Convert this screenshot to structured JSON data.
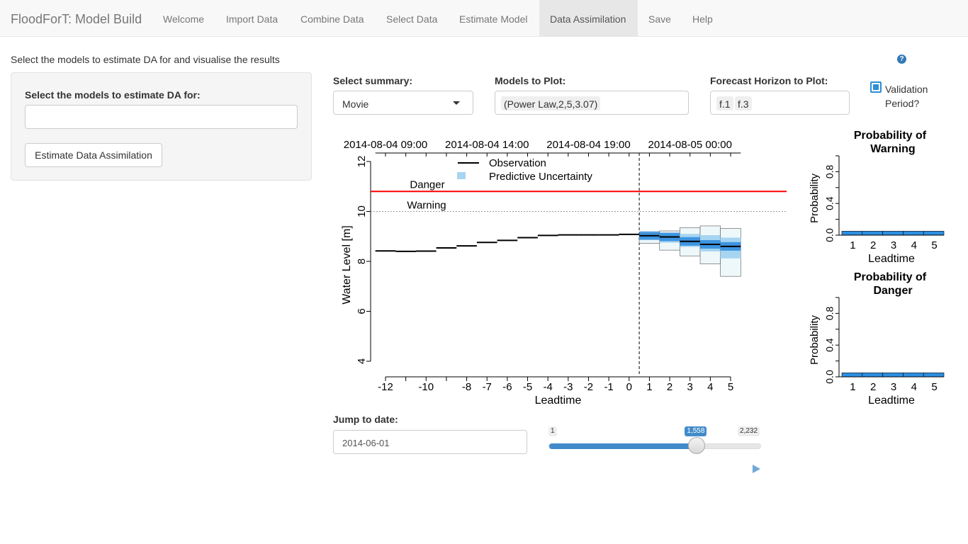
{
  "app": {
    "title": "FloodForT: Model Build"
  },
  "nav": {
    "tabs": [
      {
        "label": "Welcome"
      },
      {
        "label": "Import Data"
      },
      {
        "label": "Combine Data"
      },
      {
        "label": "Select Data"
      },
      {
        "label": "Estimate Model"
      },
      {
        "label": "Data Assimilation",
        "active": true
      },
      {
        "label": "Save"
      },
      {
        "label": "Help"
      }
    ]
  },
  "page": {
    "intro": "Select the models to estimate DA for and visualise the results",
    "help_icon": "?"
  },
  "sidebar": {
    "models_label": "Select the models to estimate DA for:",
    "models_value": "",
    "estimate_button": "Estimate Data Assimilation"
  },
  "controls": {
    "summary_label": "Select summary:",
    "summary_value": "Movie",
    "models_plot_label": "Models to Plot:",
    "models_plot_tags": [
      "(Power Law,2,5,3.07)"
    ],
    "horizon_label": "Forecast Horizon to Plot:",
    "horizon_tags": [
      "f.1",
      "f.3"
    ],
    "validation_label_line1": "Validation",
    "validation_label_line2": "Period?",
    "validation_checked": true
  },
  "jump": {
    "label": "Jump to date:",
    "value": "2014-06-01"
  },
  "slider": {
    "min": 1,
    "max": 2232,
    "value": 1558,
    "min_label": "1",
    "max_label": "2,232",
    "value_label": "1,558"
  },
  "colors": {
    "observation": "#000000",
    "uncertainty": "#a6d5f2",
    "uncertainty_dark": "#1a7fd9",
    "danger": "#ff0000",
    "warning": "#999999",
    "prob_bar": "#2c8fe0"
  },
  "chart_data": [
    {
      "type": "line",
      "ylabel": "Water Level [m]",
      "xlabel": "Leadtime",
      "ylim": [
        4,
        12
      ],
      "yticks": [
        "4",
        "6",
        "8",
        "10",
        "12"
      ],
      "x_ticks": [
        {
          "x": -12,
          "label": "-12"
        },
        {
          "x": -11,
          "label": ""
        },
        {
          "x": -10,
          "label": "-10"
        },
        {
          "x": -9,
          "label": ""
        },
        {
          "x": -8,
          "label": "-8"
        },
        {
          "x": -7,
          "label": "-7"
        },
        {
          "x": -6,
          "label": "-6"
        },
        {
          "x": -5,
          "label": "-5"
        },
        {
          "x": -4,
          "label": "-4"
        },
        {
          "x": -3,
          "label": "-3"
        },
        {
          "x": -2,
          "label": "-2"
        },
        {
          "x": -1,
          "label": "-1"
        },
        {
          "x": 0,
          "label": "0"
        },
        {
          "x": 1,
          "label": "1"
        },
        {
          "x": 2,
          "label": "2"
        },
        {
          "x": 3,
          "label": "3"
        },
        {
          "x": 4,
          "label": "4"
        },
        {
          "x": 5,
          "label": "5"
        }
      ],
      "top_axis": [
        {
          "x": -12,
          "label": "2014-08-04 09:00"
        },
        {
          "x": -7,
          "label": "2014-08-04 14:00"
        },
        {
          "x": -2,
          "label": "2014-08-04 19:00"
        },
        {
          "x": 3,
          "label": "2014-08-05 00:00"
        }
      ],
      "thresholds": [
        {
          "name": "Danger",
          "y": 10.8
        },
        {
          "name": "Warning",
          "y": 10.0
        }
      ],
      "legend": [
        "Observation",
        "Predictive Uncertainty"
      ],
      "legend_position": "top",
      "forecast_origin_x": 0.5,
      "observation": [
        {
          "x0": -12.5,
          "x1": -11.5,
          "y": 8.42
        },
        {
          "x0": -11.5,
          "x1": -10.5,
          "y": 8.4
        },
        {
          "x0": -10.5,
          "x1": -9.5,
          "y": 8.41
        },
        {
          "x0": -9.5,
          "x1": -8.5,
          "y": 8.54
        },
        {
          "x0": -8.5,
          "x1": -7.5,
          "y": 8.62
        },
        {
          "x0": -7.5,
          "x1": -6.5,
          "y": 8.76
        },
        {
          "x0": -6.5,
          "x1": -5.5,
          "y": 8.84
        },
        {
          "x0": -5.5,
          "x1": -4.5,
          "y": 8.95
        },
        {
          "x0": -4.5,
          "x1": -3.5,
          "y": 9.04
        },
        {
          "x0": -3.5,
          "x1": -2.5,
          "y": 9.06
        },
        {
          "x0": -2.5,
          "x1": -1.5,
          "y": 9.06
        },
        {
          "x0": -1.5,
          "x1": -0.5,
          "y": 9.06
        },
        {
          "x0": -0.5,
          "x1": 0.5,
          "y": 9.08
        }
      ],
      "forecast": [
        {
          "x": 1,
          "median": 9.03,
          "q05": 8.72,
          "q25": 8.9,
          "q75": 9.08,
          "q95": 9.12
        },
        {
          "x": 2,
          "median": 8.98,
          "q05": 8.45,
          "q25": 8.75,
          "q75": 9.12,
          "q95": 9.22
        },
        {
          "x": 3,
          "median": 8.8,
          "q05": 8.22,
          "q25": 8.58,
          "q75": 9.1,
          "q95": 9.35
        },
        {
          "x": 4,
          "median": 8.68,
          "q05": 7.9,
          "q25": 8.4,
          "q75": 9.05,
          "q95": 9.42
        },
        {
          "x": 5,
          "median": 8.6,
          "q05": 7.4,
          "q25": 8.12,
          "q75": 8.95,
          "q95": 9.32
        }
      ]
    },
    {
      "type": "bar",
      "title_line1": "Probability of",
      "title_line2": "Warning",
      "xlabel": "Leadtime",
      "ylabel": "Probability",
      "ylim": [
        0,
        1
      ],
      "yticks": [
        "0.0",
        "0.4",
        "0.8"
      ],
      "categories": [
        "1",
        "2",
        "3",
        "4",
        "5"
      ],
      "values": [
        0.05,
        0.05,
        0.05,
        0.05,
        0.05
      ]
    },
    {
      "type": "bar",
      "title_line1": "Probability of",
      "title_line2": "Danger",
      "xlabel": "Leadtime",
      "ylabel": "Probability",
      "ylim": [
        0,
        1
      ],
      "yticks": [
        "0.0",
        "0.4",
        "0.8"
      ],
      "categories": [
        "1",
        "2",
        "3",
        "4",
        "5"
      ],
      "values": [
        0.05,
        0.05,
        0.05,
        0.05,
        0.05
      ]
    }
  ]
}
